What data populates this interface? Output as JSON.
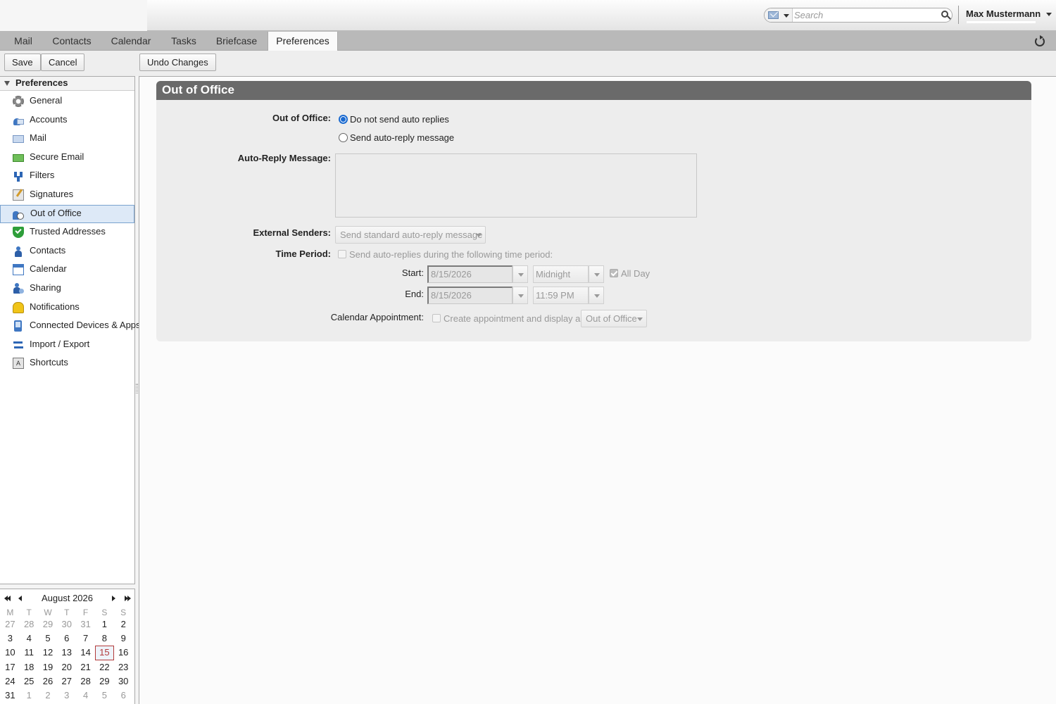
{
  "header": {
    "search": {
      "placeholder": "Search",
      "type_icon": "envelope-icon"
    },
    "user_name": "Max Mustermann"
  },
  "app_tabs": [
    "Mail",
    "Contacts",
    "Calendar",
    "Tasks",
    "Briefcase",
    "Preferences"
  ],
  "active_tab": "Preferences",
  "toolbar": {
    "save": "Save",
    "cancel": "Cancel",
    "undo": "Undo Changes"
  },
  "overview": {
    "title": "Preferences",
    "items": [
      {
        "label": "General",
        "icon": "gear-icon"
      },
      {
        "label": "Accounts",
        "icon": "accounts-icon"
      },
      {
        "label": "Mail",
        "icon": "mail-icon"
      },
      {
        "label": "Secure Email",
        "icon": "secure-email-icon"
      },
      {
        "label": "Filters",
        "icon": "filters-icon"
      },
      {
        "label": "Signatures",
        "icon": "signature-icon"
      },
      {
        "label": "Out of Office",
        "icon": "out-of-office-icon",
        "selected": true
      },
      {
        "label": "Trusted Addresses",
        "icon": "shield-icon"
      },
      {
        "label": "Contacts",
        "icon": "contacts-icon"
      },
      {
        "label": "Calendar",
        "icon": "calendar-icon"
      },
      {
        "label": "Sharing",
        "icon": "sharing-icon"
      },
      {
        "label": "Notifications",
        "icon": "bell-icon"
      },
      {
        "label": "Connected Devices & Apps",
        "icon": "device-icon"
      },
      {
        "label": "Import / Export",
        "icon": "import-export-icon"
      },
      {
        "label": "Shortcuts",
        "icon": "keyboard-icon"
      }
    ]
  },
  "minical": {
    "month_label": "August 2026",
    "weekdays": [
      "M",
      "T",
      "W",
      "T",
      "F",
      "S",
      "S"
    ],
    "weeks": [
      [
        "27",
        "28",
        "29",
        "30",
        "31",
        "1",
        "2"
      ],
      [
        "3",
        "4",
        "5",
        "6",
        "7",
        "8",
        "9"
      ],
      [
        "10",
        "11",
        "12",
        "13",
        "14",
        "15",
        "16"
      ],
      [
        "17",
        "18",
        "19",
        "20",
        "21",
        "22",
        "23"
      ],
      [
        "24",
        "25",
        "26",
        "27",
        "28",
        "29",
        "30"
      ],
      [
        "31",
        "1",
        "2",
        "3",
        "4",
        "5",
        "6"
      ]
    ],
    "today": "15"
  },
  "ooo": {
    "section_title": "Out of Office",
    "status_label": "Out of Office:",
    "option_no_reply": "Do not send auto replies",
    "option_auto_reply": "Send auto-reply message",
    "selected_option": "Do not send auto replies",
    "message_label": "Auto-Reply Message:",
    "message_value": "",
    "external_label": "External Senders:",
    "external_value": "Send standard auto-reply message",
    "time_period_label": "Time Period:",
    "time_period_check": "Send auto-replies during the following time period:",
    "start_label": "Start:",
    "start_date": "8/15/2026",
    "start_time": "Midnight",
    "all_day_label": "All Day",
    "end_label": "End:",
    "end_date": "8/15/2026",
    "end_time": "11:59 PM",
    "cal_appt_label": "Calendar Appointment:",
    "cal_appt_check": "Create appointment and display as:",
    "cal_appt_value": "Out of Office"
  },
  "colors": {
    "accent": "#1a6ad0",
    "section_header": "#6a6a6a",
    "selected_row": "#dde9f7",
    "today_border": "#b23a3a"
  }
}
